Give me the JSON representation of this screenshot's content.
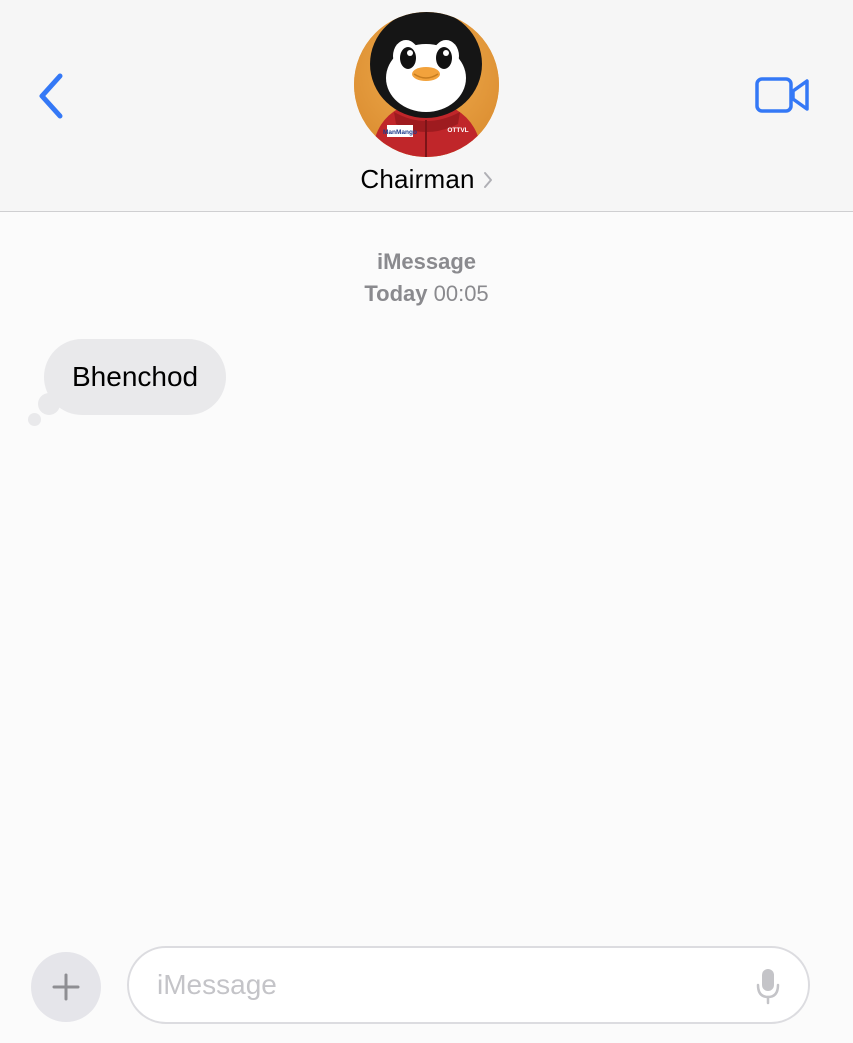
{
  "header": {
    "contact_name": "Chairman",
    "back_icon": "chevron-left-icon",
    "video_icon": "video-camera-icon",
    "chevron_icon": "chevron-right-icon",
    "avatar_jacket_label_left": "ManMango",
    "avatar_jacket_label_right": "OTTVL"
  },
  "thread": {
    "service": "iMessage",
    "day": "Today",
    "time": "00:05",
    "messages": [
      {
        "direction": "incoming",
        "text": "Bhenchod"
      }
    ]
  },
  "composer": {
    "plus_icon": "plus-icon",
    "placeholder": "iMessage",
    "value": "",
    "mic_icon": "microphone-icon"
  },
  "colors": {
    "accent": "#3478f6",
    "incoming_bubble": "#e9e9eb",
    "header_bg": "#f6f6f6",
    "meta_text": "#8a8a8e"
  }
}
